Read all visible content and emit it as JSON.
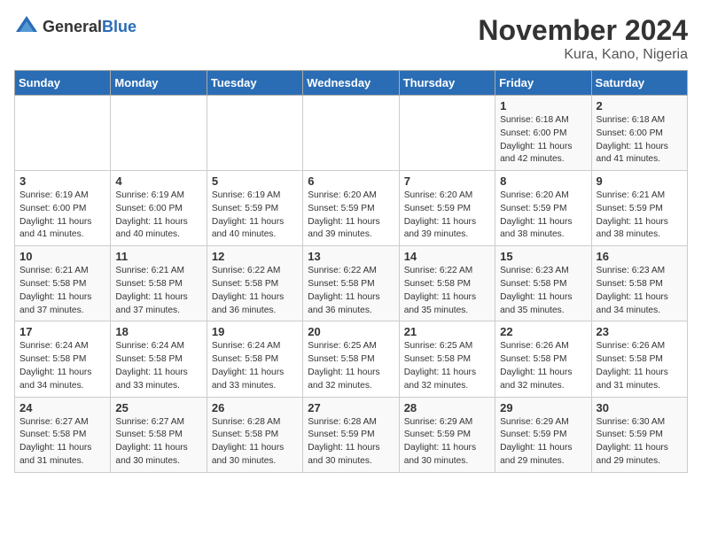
{
  "logo": {
    "general": "General",
    "blue": "Blue"
  },
  "title": "November 2024",
  "location": "Kura, Kano, Nigeria",
  "days_of_week": [
    "Sunday",
    "Monday",
    "Tuesday",
    "Wednesday",
    "Thursday",
    "Friday",
    "Saturday"
  ],
  "weeks": [
    [
      {
        "day": "",
        "info": ""
      },
      {
        "day": "",
        "info": ""
      },
      {
        "day": "",
        "info": ""
      },
      {
        "day": "",
        "info": ""
      },
      {
        "day": "",
        "info": ""
      },
      {
        "day": "1",
        "info": "Sunrise: 6:18 AM\nSunset: 6:00 PM\nDaylight: 11 hours and 42 minutes."
      },
      {
        "day": "2",
        "info": "Sunrise: 6:18 AM\nSunset: 6:00 PM\nDaylight: 11 hours and 41 minutes."
      }
    ],
    [
      {
        "day": "3",
        "info": "Sunrise: 6:19 AM\nSunset: 6:00 PM\nDaylight: 11 hours and 41 minutes."
      },
      {
        "day": "4",
        "info": "Sunrise: 6:19 AM\nSunset: 6:00 PM\nDaylight: 11 hours and 40 minutes."
      },
      {
        "day": "5",
        "info": "Sunrise: 6:19 AM\nSunset: 5:59 PM\nDaylight: 11 hours and 40 minutes."
      },
      {
        "day": "6",
        "info": "Sunrise: 6:20 AM\nSunset: 5:59 PM\nDaylight: 11 hours and 39 minutes."
      },
      {
        "day": "7",
        "info": "Sunrise: 6:20 AM\nSunset: 5:59 PM\nDaylight: 11 hours and 39 minutes."
      },
      {
        "day": "8",
        "info": "Sunrise: 6:20 AM\nSunset: 5:59 PM\nDaylight: 11 hours and 38 minutes."
      },
      {
        "day": "9",
        "info": "Sunrise: 6:21 AM\nSunset: 5:59 PM\nDaylight: 11 hours and 38 minutes."
      }
    ],
    [
      {
        "day": "10",
        "info": "Sunrise: 6:21 AM\nSunset: 5:58 PM\nDaylight: 11 hours and 37 minutes."
      },
      {
        "day": "11",
        "info": "Sunrise: 6:21 AM\nSunset: 5:58 PM\nDaylight: 11 hours and 37 minutes."
      },
      {
        "day": "12",
        "info": "Sunrise: 6:22 AM\nSunset: 5:58 PM\nDaylight: 11 hours and 36 minutes."
      },
      {
        "day": "13",
        "info": "Sunrise: 6:22 AM\nSunset: 5:58 PM\nDaylight: 11 hours and 36 minutes."
      },
      {
        "day": "14",
        "info": "Sunrise: 6:22 AM\nSunset: 5:58 PM\nDaylight: 11 hours and 35 minutes."
      },
      {
        "day": "15",
        "info": "Sunrise: 6:23 AM\nSunset: 5:58 PM\nDaylight: 11 hours and 35 minutes."
      },
      {
        "day": "16",
        "info": "Sunrise: 6:23 AM\nSunset: 5:58 PM\nDaylight: 11 hours and 34 minutes."
      }
    ],
    [
      {
        "day": "17",
        "info": "Sunrise: 6:24 AM\nSunset: 5:58 PM\nDaylight: 11 hours and 34 minutes."
      },
      {
        "day": "18",
        "info": "Sunrise: 6:24 AM\nSunset: 5:58 PM\nDaylight: 11 hours and 33 minutes."
      },
      {
        "day": "19",
        "info": "Sunrise: 6:24 AM\nSunset: 5:58 PM\nDaylight: 11 hours and 33 minutes."
      },
      {
        "day": "20",
        "info": "Sunrise: 6:25 AM\nSunset: 5:58 PM\nDaylight: 11 hours and 32 minutes."
      },
      {
        "day": "21",
        "info": "Sunrise: 6:25 AM\nSunset: 5:58 PM\nDaylight: 11 hours and 32 minutes."
      },
      {
        "day": "22",
        "info": "Sunrise: 6:26 AM\nSunset: 5:58 PM\nDaylight: 11 hours and 32 minutes."
      },
      {
        "day": "23",
        "info": "Sunrise: 6:26 AM\nSunset: 5:58 PM\nDaylight: 11 hours and 31 minutes."
      }
    ],
    [
      {
        "day": "24",
        "info": "Sunrise: 6:27 AM\nSunset: 5:58 PM\nDaylight: 11 hours and 31 minutes."
      },
      {
        "day": "25",
        "info": "Sunrise: 6:27 AM\nSunset: 5:58 PM\nDaylight: 11 hours and 30 minutes."
      },
      {
        "day": "26",
        "info": "Sunrise: 6:28 AM\nSunset: 5:58 PM\nDaylight: 11 hours and 30 minutes."
      },
      {
        "day": "27",
        "info": "Sunrise: 6:28 AM\nSunset: 5:59 PM\nDaylight: 11 hours and 30 minutes."
      },
      {
        "day": "28",
        "info": "Sunrise: 6:29 AM\nSunset: 5:59 PM\nDaylight: 11 hours and 30 minutes."
      },
      {
        "day": "29",
        "info": "Sunrise: 6:29 AM\nSunset: 5:59 PM\nDaylight: 11 hours and 29 minutes."
      },
      {
        "day": "30",
        "info": "Sunrise: 6:30 AM\nSunset: 5:59 PM\nDaylight: 11 hours and 29 minutes."
      }
    ]
  ]
}
